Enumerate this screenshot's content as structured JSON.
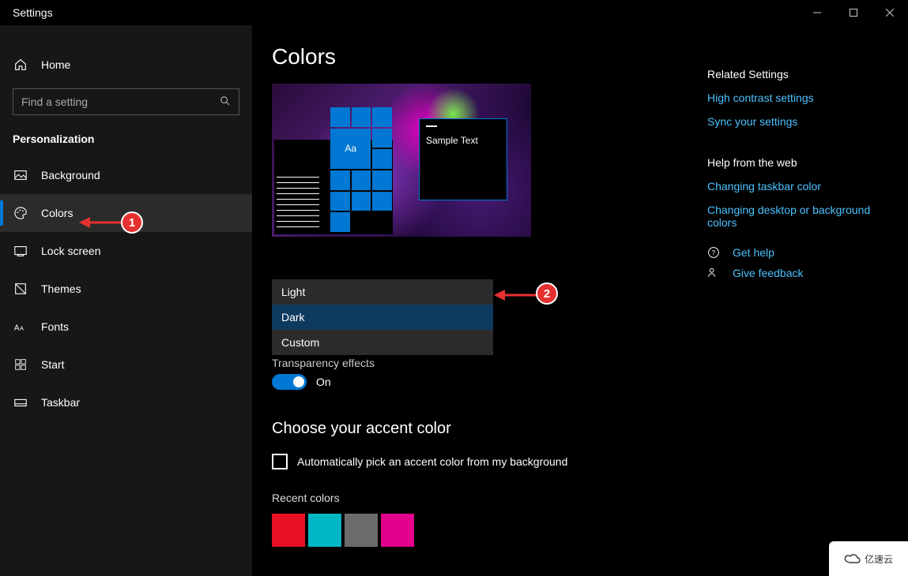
{
  "window": {
    "title": "Settings"
  },
  "sidebar": {
    "home": "Home",
    "search_placeholder": "Find a setting",
    "section": "Personalization",
    "items": [
      {
        "label": "Background"
      },
      {
        "label": "Colors"
      },
      {
        "label": "Lock screen"
      },
      {
        "label": "Themes"
      },
      {
        "label": "Fonts"
      },
      {
        "label": "Start"
      },
      {
        "label": "Taskbar"
      }
    ]
  },
  "page": {
    "title": "Colors"
  },
  "preview": {
    "sample_text": "Sample Text",
    "tile_text": "Aa"
  },
  "color_mode": {
    "options": [
      {
        "label": "Light"
      },
      {
        "label": "Dark"
      },
      {
        "label": "Custom"
      }
    ]
  },
  "transparency": {
    "label": "Transparency effects",
    "state": "On"
  },
  "accent": {
    "heading": "Choose your accent color",
    "auto_label": "Automatically pick an accent color from my background",
    "recent_heading": "Recent colors",
    "recent": [
      "#e81123",
      "#00b7c3",
      "#6b6b6b",
      "#e3008c"
    ]
  },
  "related": {
    "heading": "Related Settings",
    "links": [
      "High contrast settings",
      "Sync your settings"
    ]
  },
  "help": {
    "heading": "Help from the web",
    "links": [
      "Changing taskbar color",
      "Changing desktop or background colors"
    ],
    "get_help": "Get help",
    "feedback": "Give feedback"
  },
  "annotations": {
    "badge1": "1",
    "badge2": "2"
  },
  "watermark": "亿速云"
}
